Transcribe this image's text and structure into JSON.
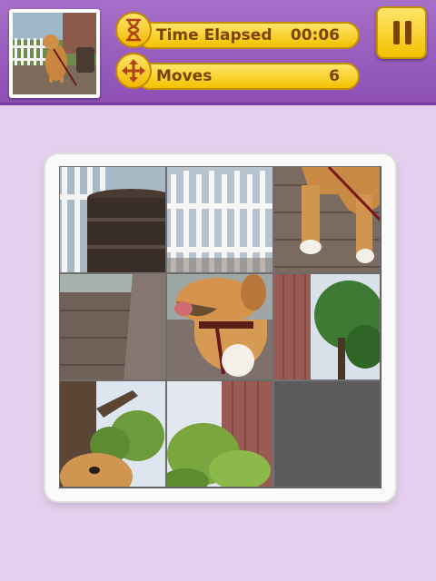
{
  "hud": {
    "time_label": "Time Elapsed",
    "time_value": "00:06",
    "moves_label": "Moves",
    "moves_value": "6"
  },
  "icons": {
    "time": "hourglass-icon",
    "moves": "move-arrows-icon",
    "pause": "pause-icon"
  },
  "puzzle": {
    "grid": "3x3",
    "empty_position": "bottom-right"
  },
  "colors": {
    "background": "#e6cfee",
    "topbar": "#9b5fc2",
    "pill": "#f7d530",
    "pill_text": "#7b4300"
  }
}
